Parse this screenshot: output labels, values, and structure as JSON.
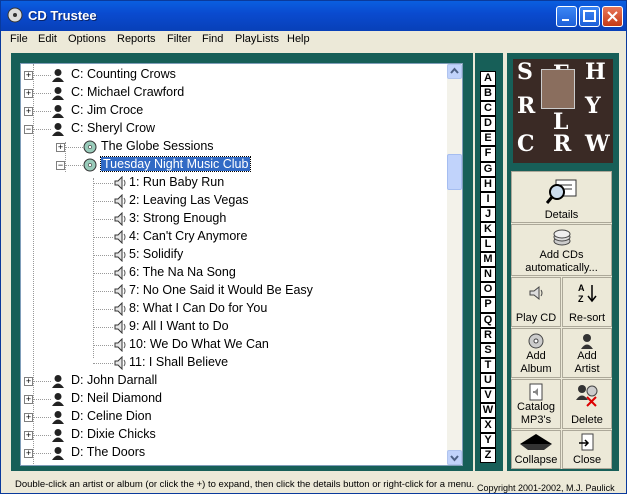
{
  "window": {
    "title": "CD Trustee"
  },
  "menu": [
    "File",
    "Edit",
    "Options",
    "Reports",
    "Filter",
    "Find",
    "PlayLists",
    "Help"
  ],
  "tree": [
    {
      "kind": "artist",
      "text": "C:  Counting Crows",
      "expander": "+"
    },
    {
      "kind": "artist",
      "text": "C:  Michael Crawford",
      "expander": "+"
    },
    {
      "kind": "artist",
      "text": "C:  Jim Croce",
      "expander": "+"
    },
    {
      "kind": "artist",
      "text": "C:  Sheryl Crow",
      "expander": "−"
    },
    {
      "kind": "album",
      "text": "The Globe Sessions",
      "expander": "+"
    },
    {
      "kind": "album",
      "text": "Tuesday Night Music Club",
      "expander": "−",
      "selected": true
    },
    {
      "kind": "track",
      "text": "1: Run Baby Run"
    },
    {
      "kind": "track",
      "text": "2: Leaving Las Vegas"
    },
    {
      "kind": "track",
      "text": "3: Strong Enough"
    },
    {
      "kind": "track",
      "text": "4: Can't Cry Anymore"
    },
    {
      "kind": "track",
      "text": "5: Solidify"
    },
    {
      "kind": "track",
      "text": "6: The Na Na Song"
    },
    {
      "kind": "track",
      "text": "7: No One Said it Would Be Easy"
    },
    {
      "kind": "track",
      "text": "8: What I Can Do for You"
    },
    {
      "kind": "track",
      "text": "9: All I Want to Do"
    },
    {
      "kind": "track",
      "text": "10: We Do What We Can"
    },
    {
      "kind": "track",
      "text": "11: I Shall Believe"
    },
    {
      "kind": "artist",
      "text": "D:  John Darnall",
      "expander": "+"
    },
    {
      "kind": "artist",
      "text": "D:  Neil Diamond",
      "expander": "+"
    },
    {
      "kind": "artist",
      "text": "D:  Celine Dion",
      "expander": "+"
    },
    {
      "kind": "artist",
      "text": "D:  Dixie Chicks",
      "expander": "+"
    },
    {
      "kind": "artist",
      "text": "D:  The Doors",
      "expander": "+"
    }
  ],
  "alphabet": [
    "A",
    "B",
    "C",
    "D",
    "E",
    "F",
    "G",
    "H",
    "I",
    "J",
    "K",
    "L",
    "M",
    "N",
    "O",
    "P",
    "Q",
    "R",
    "S",
    "T",
    "U",
    "V",
    "W",
    "X",
    "Y",
    "Z"
  ],
  "album_art_letters": [
    "S",
    "H",
    "E",
    "R",
    "Y",
    "L",
    "C",
    "R",
    "W"
  ],
  "buttons": {
    "details": "Details",
    "add_cds": [
      "Add CDs",
      "automatically..."
    ],
    "play_cd": "Play CD",
    "resort": "Re-sort",
    "add_album": [
      "Add",
      "Album"
    ],
    "add_artist": [
      "Add",
      "Artist"
    ],
    "catalog": [
      "Catalog",
      "MP3's"
    ],
    "delete": "Delete",
    "collapse": "Collapse",
    "close": "Close"
  },
  "status_text": "Double-click an artist or album (or click the +) to expand, then click the details button or right-click for a menu.",
  "copyright": "Copyright 2001-2002, M.J. Paulick",
  "colors": {
    "titlebar": "#0a4bd0",
    "frame": "#175f58",
    "selection": "#316ac5"
  }
}
